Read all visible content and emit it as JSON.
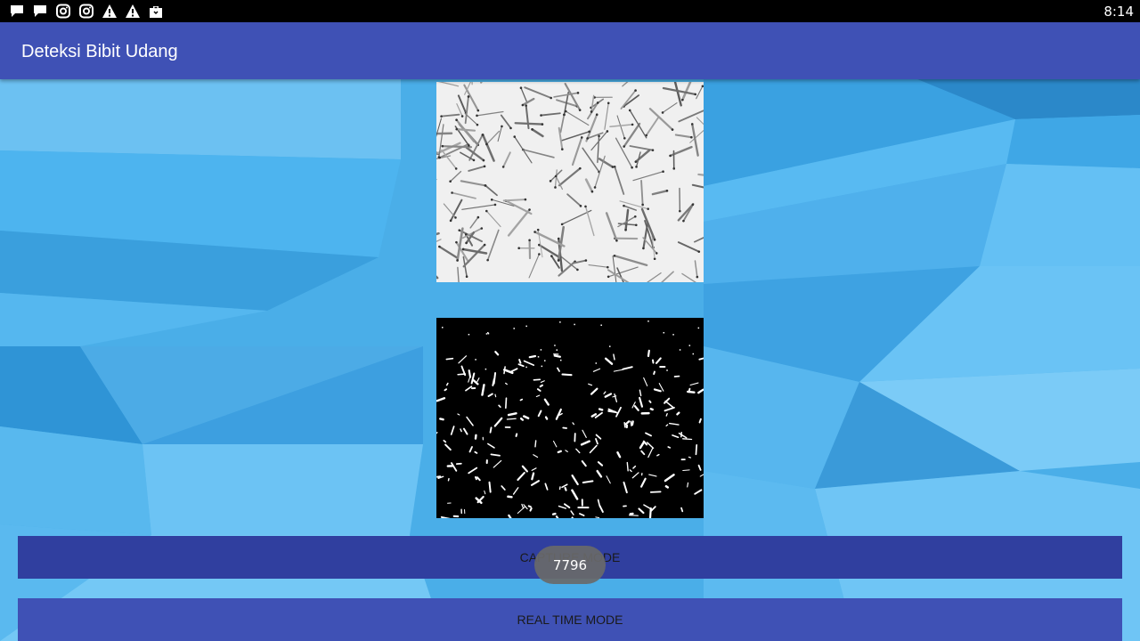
{
  "status_bar": {
    "time": "8:14",
    "icons": [
      "message-icon",
      "message-icon",
      "instagram-icon",
      "instagram-icon",
      "warning-icon",
      "warning-icon",
      "briefcase-icon"
    ]
  },
  "app_bar": {
    "title": "Deteksi Bibit Udang"
  },
  "images": {
    "original": "grayscale-shrimp-fry-photo",
    "processed": "binary-threshold-mask"
  },
  "buttons": {
    "capture_label": "CAPTURE MODE",
    "realtime_label": "REAL TIME MODE"
  },
  "toast": {
    "text": "7796"
  },
  "colors": {
    "primary": "#3f51b5",
    "primary_dark": "#303f9f",
    "status_bar": "#000000",
    "background": "#4fb1ec"
  }
}
